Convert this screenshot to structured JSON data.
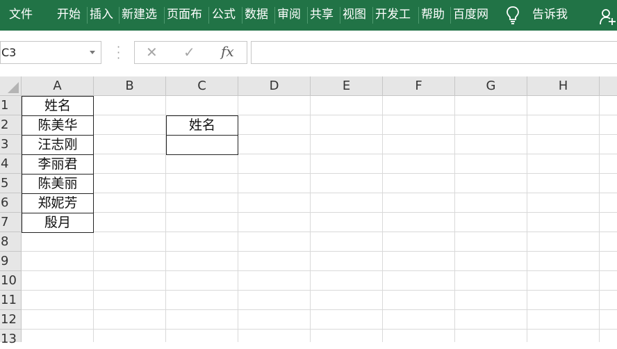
{
  "ribbon": {
    "tabs": [
      "文件",
      "开始",
      "插入",
      "新建选",
      "页面布",
      "公式",
      "数据",
      "审阅",
      "共享",
      "视图",
      "开发工",
      "帮助",
      "百度网"
    ],
    "tell_me": "告诉我",
    "bg_color": "#217346"
  },
  "formula_bar": {
    "name_box": "C3",
    "fx_label": "fx",
    "formula": ""
  },
  "grid": {
    "columns": [
      "A",
      "B",
      "C",
      "D",
      "E",
      "F",
      "G",
      "H"
    ],
    "rows": [
      "1",
      "2",
      "3",
      "4",
      "5",
      "6",
      "7",
      "8",
      "9",
      "10",
      "11",
      "12",
      "13"
    ],
    "A": [
      "姓名",
      "陈美华",
      "汪志刚",
      "李丽君",
      "陈美丽",
      "郑妮芳",
      "殷月"
    ],
    "C2": "姓名",
    "C3": ""
  }
}
